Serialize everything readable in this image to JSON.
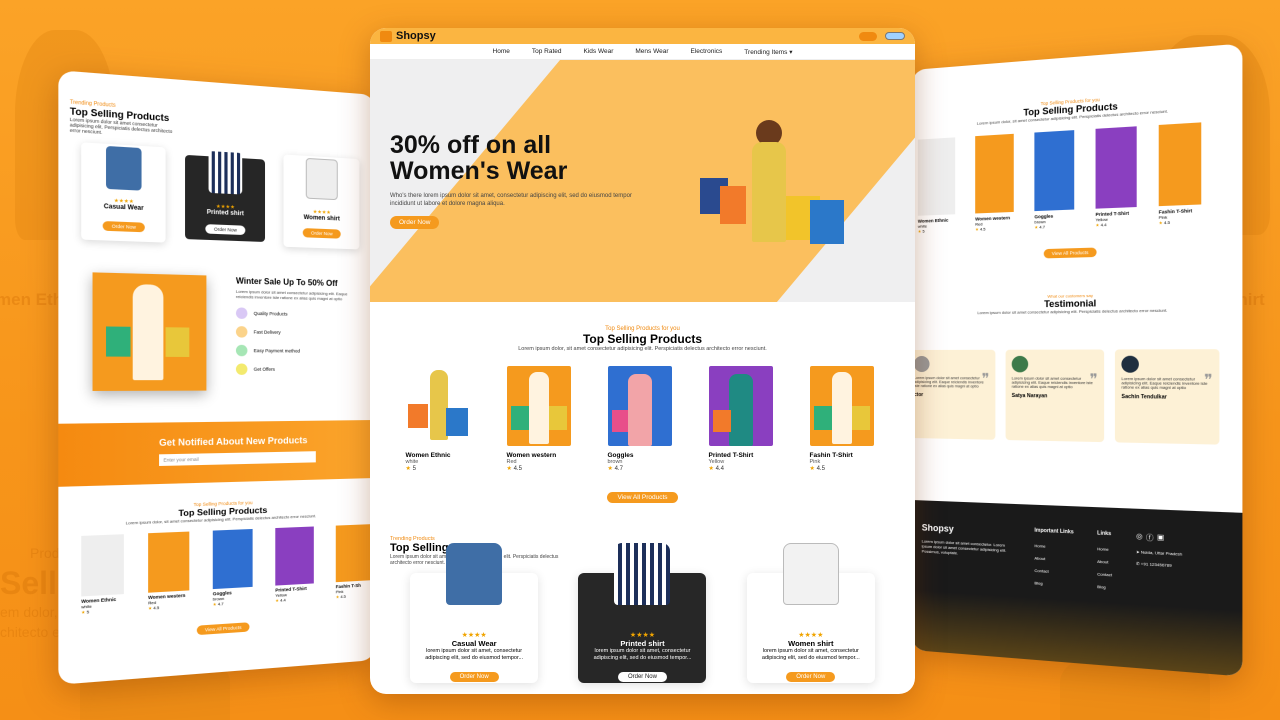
{
  "ghost": {
    "left_text1": "men Ethn",
    "left_text2": "Products",
    "left_text3": "Selli",
    "left_text4": "em dolor, sit",
    "left_text5": "chitecto erro",
    "right_text1": "Shirt"
  },
  "center": {
    "brand": "Shopsy",
    "nav": [
      "Home",
      "Top Rated",
      "Kids Wear",
      "Mens Wear",
      "Electronics",
      "Trending Items ▾"
    ],
    "hero": {
      "title_line1": "30% off on all",
      "title_line2": "Women's Wear",
      "desc": "Who's there lorem ipsum dolor sit amet, consectetur adipiscing elit, sed do eiusmod tempor incididunt ut labore et dolore magna aliqua.",
      "button": "Order Now"
    },
    "top_selling": {
      "kicker": "Top Selling Products for you",
      "title": "Top Selling Products",
      "desc": "Lorem ipsum dolor, sit amet consectetur adipisicing elit. Perspiciatis delectus architecto error nesciunt.",
      "products": [
        {
          "name": "Women Ethnic",
          "sub": "white",
          "rating": "5"
        },
        {
          "name": "Women western",
          "sub": "Red",
          "rating": "4.5"
        },
        {
          "name": "Goggles",
          "sub": "brown",
          "rating": "4.7"
        },
        {
          "name": "Printed T-Shirt",
          "sub": "Yellow",
          "rating": "4.4"
        },
        {
          "name": "Fashin T-Shirt",
          "sub": "Pink",
          "rating": "4.5"
        }
      ],
      "button": "View All Products"
    },
    "trending": {
      "kicker": "Trending Products",
      "title": "Top Selling Products",
      "desc": "Lorem ipsum dolor sit amet consectetur adipisicing elit. Perspiciatis delectus architecto error nesciunt.",
      "cards": [
        {
          "name": "Casual Wear",
          "desc": "lorem ipsum dolor sit amet, consectetur adipiscing elit, sed do eiusmod tempor...",
          "button": "Order Now"
        },
        {
          "name": "Printed shirt",
          "desc": "lorem ipsum dolor sit amet, consectetur adipiscing elit, sed do eiusmod tempor...",
          "button": "Order Now"
        },
        {
          "name": "Women shirt",
          "desc": "lorem ipsum dolor sit amet, consectetur adipiscing elit, sed do eiusmod tempor...",
          "button": "Order Now"
        }
      ]
    }
  },
  "left": {
    "kicker": "Trending Products",
    "title": "Top Selling Products",
    "desc": "Lorem ipsum dolor sit amet consectetur adipisicing elit. Perspiciatis delectus architecto error nesciunt.",
    "cards": [
      {
        "name": "Casual Wear",
        "button": "Order Now"
      },
      {
        "name": "Printed shirt",
        "button": "Order Now"
      },
      {
        "name": "Women shirt",
        "button": "Order Now"
      }
    ],
    "sale_title": "Winter Sale Up To 50% Off",
    "sale_desc": "Lorem ipsum dolor sit amet consectetur adipisicing elit. Eaque reiciendis inventore iste ratione ex alias quis magni at optio",
    "features": [
      "Quality Products",
      "Fast Delivery",
      "Easy Payment method",
      "Get Offers"
    ],
    "notify_title": "Get Notified About New Products",
    "notify_placeholder": "Enter your email",
    "bottom_kicker": "Top Selling Products for you",
    "bottom_title": "Top Selling Products",
    "bottom_desc": "Lorem ipsum dolor, sit amet consectetur adipisicing elit. Perspiciatis delectus architecto error nesciunt.",
    "bottom_products": [
      {
        "name": "Women Ethnic",
        "sub": "white",
        "rating": "5"
      },
      {
        "name": "Women western",
        "sub": "Red",
        "rating": "4.5"
      },
      {
        "name": "Goggles",
        "sub": "brown",
        "rating": "4.7"
      },
      {
        "name": "Printed T-Shirt",
        "sub": "Yellow",
        "rating": "4.4"
      },
      {
        "name": "Fashin T-Sh",
        "sub": "Pink",
        "rating": "4.5"
      }
    ],
    "bottom_button": "View All Products"
  },
  "right": {
    "kicker": "Top Selling Products for you",
    "title": "Top Selling Products",
    "desc": "Lorem ipsum dolor, sit amet consectetur adipisicing elit. Perspiciatis delectus architecto error nesciunt.",
    "products": [
      {
        "name": "Women Ethnic",
        "sub": "white",
        "rating": "5"
      },
      {
        "name": "Women western",
        "sub": "Red",
        "rating": "4.5"
      },
      {
        "name": "Goggles",
        "sub": "brown",
        "rating": "4.7"
      },
      {
        "name": "Printed T-Shirt",
        "sub": "Yellow",
        "rating": "4.4"
      },
      {
        "name": "Fashin T-Shirt",
        "sub": "Pink",
        "rating": "4.5"
      }
    ],
    "button": "View All Products",
    "testimonial_kicker": "What our customers say",
    "testimonial_title": "Testimonial",
    "testimonial_desc": "Lorem ipsum dolor sit amet consectetur adipisicing elit. Perspiciatis delectus architecto error nesciunt.",
    "testimonials": [
      {
        "text": "Lorem ipsum dolor sit amet consectetur adipisicing elit. Eaque reiciendis inventore iste ratione ex alias quis magni at optio",
        "name": "ctor"
      },
      {
        "text": "Lorem ipsum dolor sit amet consectetur adipisicing elit. Eaque reiciendis inventore iste ratione ex alias quis magni at optio",
        "name": "Satya Narayan"
      },
      {
        "text": "Lorem ipsum dolor sit amet consectetur adipisicing elit. Eaque reiciendis inventore iste ratione ex alias quis magni at optio",
        "name": "Sachin Tendulkar"
      }
    ],
    "footer": {
      "brand": "Shopsy",
      "about": "Lorem ipsum dolor sit amet consectetur. Lorem ipsum dolor sit amet consectetur adipisicing elit. Possimus, voluptate.",
      "important_title": "Important Links",
      "important": [
        "Home",
        "About",
        "Contact",
        "Blog"
      ],
      "links_title": "Links",
      "links": [
        "Home",
        "About",
        "Contact",
        "Blog"
      ],
      "address": "Noida, Uttar Pradesh",
      "phone": "+91 123456789"
    }
  }
}
